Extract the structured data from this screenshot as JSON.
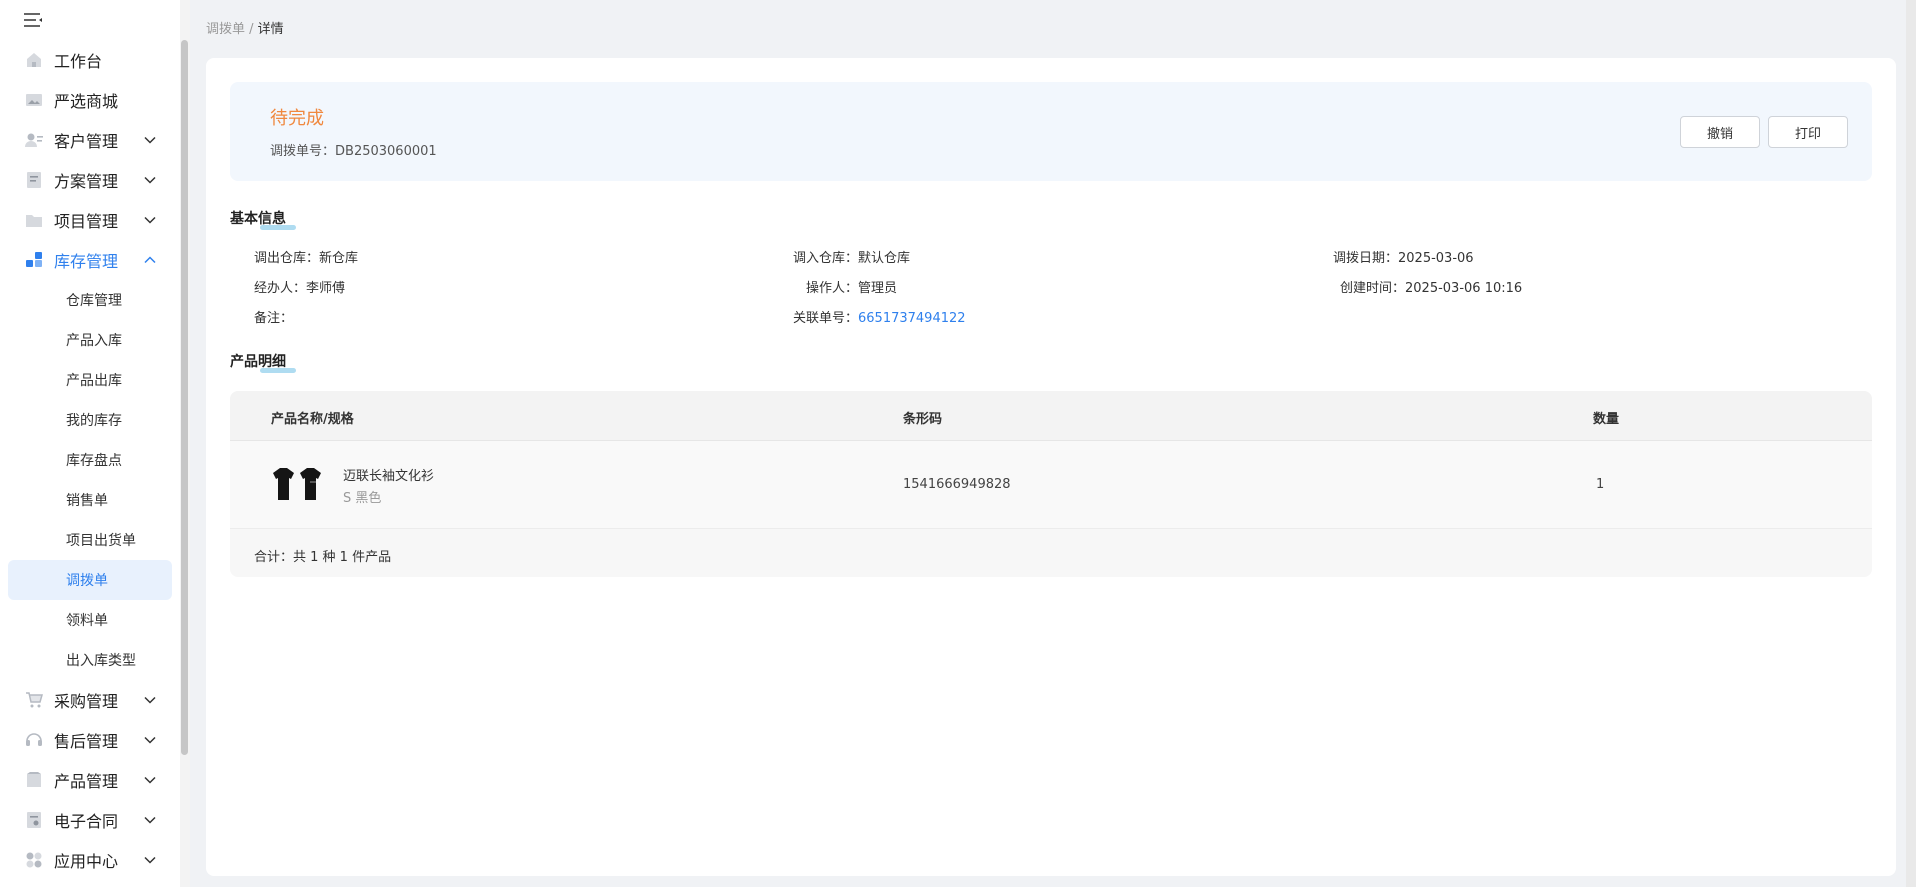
{
  "sidebar": {
    "items": [
      {
        "label": "工作台",
        "icon": "home-icon"
      },
      {
        "label": "严选商城",
        "icon": "image-icon"
      },
      {
        "label": "客户管理",
        "icon": "customer-icon"
      },
      {
        "label": "方案管理",
        "icon": "document-icon"
      },
      {
        "label": "项目管理",
        "icon": "folder-icon"
      },
      {
        "label": "库存管理",
        "icon": "inventory-icon"
      },
      {
        "label": "采购管理",
        "icon": "cart-icon"
      },
      {
        "label": "售后管理",
        "icon": "headset-icon"
      },
      {
        "label": "产品管理",
        "icon": "box-icon"
      },
      {
        "label": "电子合同",
        "icon": "contract-icon"
      },
      {
        "label": "应用中心",
        "icon": "apps-icon"
      }
    ],
    "sub_items": [
      "仓库管理",
      "产品入库",
      "产品出库",
      "我的库存",
      "库存盘点",
      "销售单",
      "项目出货单",
      "调拨单",
      "领料单",
      "出入库类型"
    ],
    "active_sub": "调拨单",
    "accent_color": "#2f80ed"
  },
  "breadcrumb": {
    "parent": "调拨单",
    "separator": " / ",
    "current": "详情"
  },
  "status": {
    "text": "待完成",
    "color": "#f0883e",
    "order_label": "调拨单号：",
    "order_no": "DB2503060001"
  },
  "actions": {
    "cancel": "撤销",
    "print": "打印"
  },
  "basic": {
    "title": "基本信息",
    "out_wh_label": "调出仓库：",
    "out_wh": "新仓库",
    "in_wh_label": "调入仓库：",
    "in_wh": "默认仓库",
    "date_label": "调拨日期：",
    "date": "2025-03-06",
    "handler_label": "经办人：",
    "handler": "李师傅",
    "operator_label": "操作人：",
    "operator": "管理员",
    "created_label": "创建时间：",
    "created": "2025-03-06 10:16",
    "remark_label": "备注：",
    "remark": "",
    "related_label": "关联单号：",
    "related": "6651737494122"
  },
  "products": {
    "title": "产品明细",
    "headers": {
      "name": "产品名称/规格",
      "barcode": "条形码",
      "qty": "数量"
    },
    "rows": [
      {
        "name": "迈联长袖文化衫",
        "spec": "S 黑色",
        "barcode": "1541666949828",
        "qty": "1"
      }
    ],
    "total": "合计：共 1 种 1 件产品"
  }
}
